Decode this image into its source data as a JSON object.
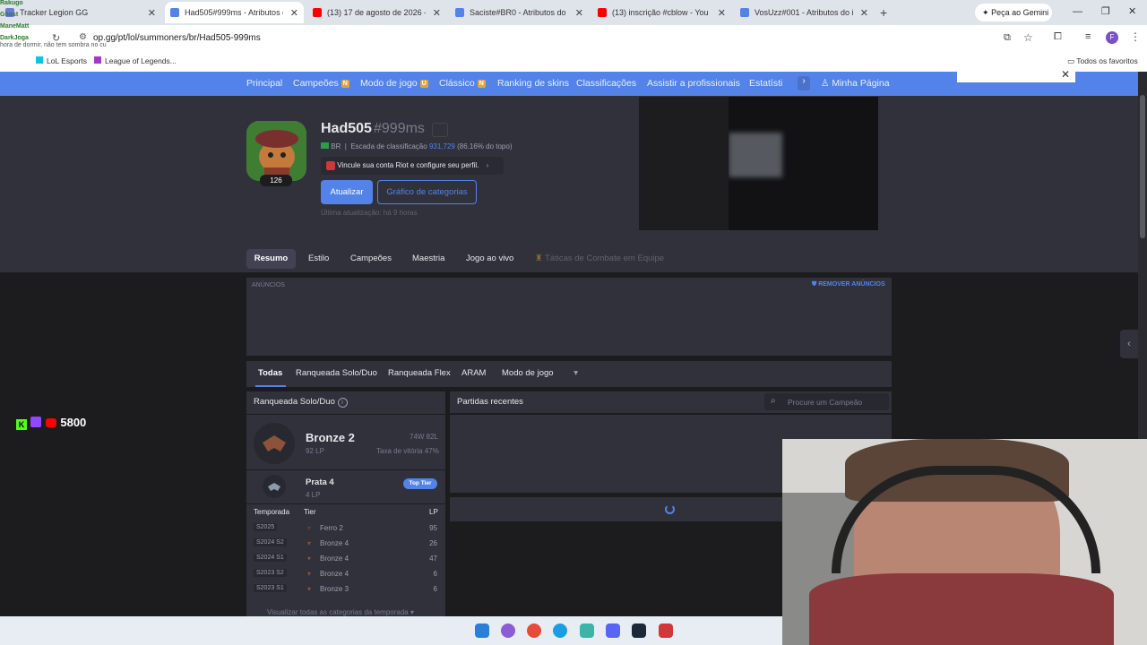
{
  "browser": {
    "tabs": [
      {
        "title": "Tracker Legion GG",
        "color": "#6b7bd1",
        "active": false
      },
      {
        "title": "Had505#999ms - Atributos do",
        "color": "#5383e8",
        "active": true
      },
      {
        "title": "(13) 17 de agosto de 2026 - Yo",
        "color": "#ff0000",
        "active": false
      },
      {
        "title": "Saciste#BR0 - Atributos do inv",
        "color": "#5383e8",
        "active": false
      },
      {
        "title": "(13) inscrição #cblow - You",
        "color": "#ff0000",
        "active": false
      },
      {
        "title": "VosUzz#001 - Atributos do inv",
        "color": "#5383e8",
        "active": false
      }
    ],
    "new_tab": "+",
    "gemini": "Peça ao Gemini",
    "url": "op.gg/pt/lol/summoners/br/Had505-999ms",
    "bookmarks": [
      "LoL Esports",
      "League of Legends..."
    ],
    "all_favorites": "Todos os favoritos",
    "profile_letter": "F"
  },
  "chat_overlay": {
    "lines": [
      "Rakugo",
      "Ghost",
      "ManeMatt",
      "DarkJoga",
      "hora de dormir, não tem sombra no cu"
    ],
    "counter": "5800"
  },
  "nav": {
    "items": [
      "Principal",
      "Campeões",
      "Modo de jogo",
      "Clássico",
      "Ranking de skins",
      "Classificações",
      "Assistir a profissionais",
      "Estatísti"
    ],
    "badges": {
      "Campeões": "N",
      "Modo de jogo": "U",
      "Clássico": "N"
    },
    "my_page": "Minha Página"
  },
  "summoner": {
    "name": "Had505",
    "tag": "#999ms",
    "level": "126",
    "region": "BR",
    "ladder_label": "Escada de classificação",
    "ladder_rank": "931,729",
    "ladder_pct": "(86.16% do topo)",
    "riot_link": "Vincule sua conta Riot e configure seu perfil.",
    "update_btn": "Atualizar",
    "category_btn": "Gráfico de categorias",
    "last_update": "Última atualização: há 9 horas"
  },
  "profile_tabs": [
    "Resumo",
    "Estilo",
    "Campeões",
    "Maestria",
    "Jogo ao vivo",
    "Táticas de Combate em Equipe"
  ],
  "ads": {
    "label": "ANÚNCIOS",
    "remove": "REMOVER ANÚNCIOS"
  },
  "queue_tabs": [
    "Todas",
    "Ranqueada Solo/Duo",
    "Ranqueada Flex",
    "ARAM",
    "Modo de jogo"
  ],
  "ranked": {
    "title": "Ranqueada Solo/Duo",
    "tier": "Bronze 2",
    "lp": "92 LP",
    "record": "74W 82L",
    "winrate": "Taxa de vitória 47%",
    "peak_tier": "Prata 4",
    "peak_lp": "4 LP",
    "top_tier": "Top Tier",
    "headers": [
      "Temporada",
      "Tier",
      "LP"
    ],
    "seasons": [
      {
        "season": "S2025",
        "tier": "Ferro 2",
        "lp": "95"
      },
      {
        "season": "S2024 S2",
        "tier": "Bronze 4",
        "lp": "26"
      },
      {
        "season": "S2024 S1",
        "tier": "Bronze 4",
        "lp": "47"
      },
      {
        "season": "S2023 S2",
        "tier": "Bronze 4",
        "lp": "6"
      },
      {
        "season": "S2023 S1",
        "tier": "Bronze 3",
        "lp": "6"
      }
    ],
    "view_all": "Visualizar todas as categorias da temporada"
  },
  "recent": {
    "title": "Partidas recentes",
    "search_placeholder": "Procure um Campeão"
  },
  "colors": {
    "brand": "#5383e8",
    "panel": "#31313c",
    "bg": "#1c1c1f",
    "bronze": "#8c523a"
  }
}
